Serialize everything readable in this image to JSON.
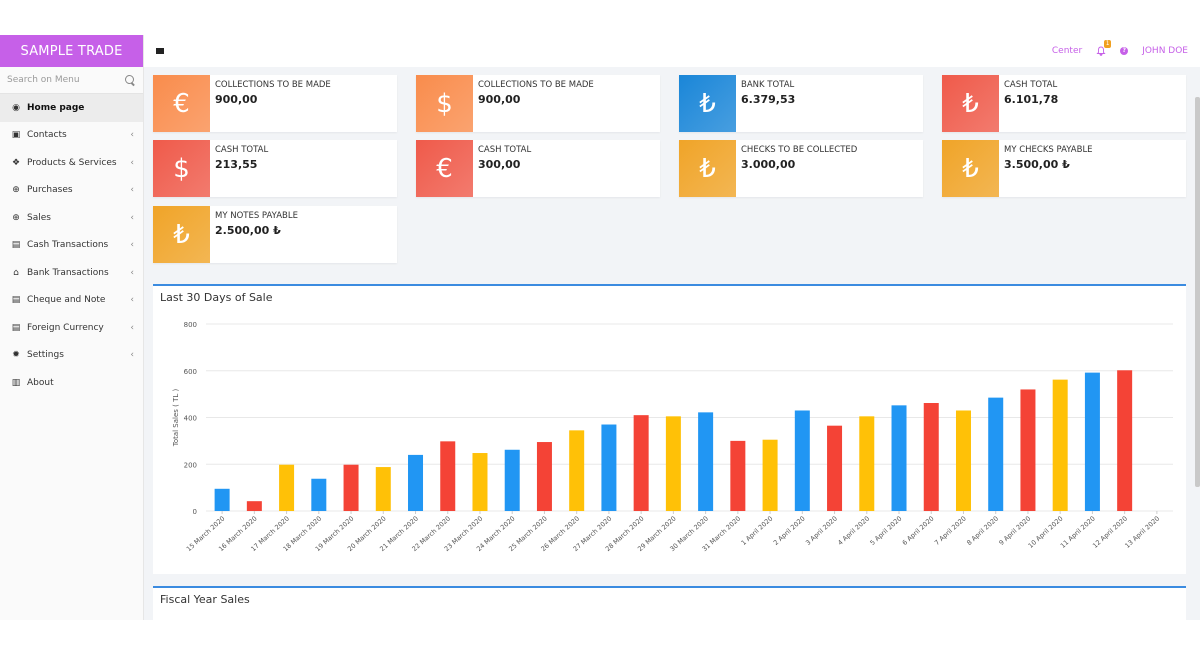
{
  "brand": "SAMPLE TRADE",
  "search": {
    "placeholder": "Search on Menu"
  },
  "sidebar": {
    "items": [
      {
        "label": "Home page",
        "icon": "dashboard-icon",
        "active": true,
        "chevron": false
      },
      {
        "label": "Contacts",
        "icon": "contacts-icon",
        "active": false,
        "chevron": true
      },
      {
        "label": "Products & Services",
        "icon": "products-icon",
        "active": false,
        "chevron": true
      },
      {
        "label": "Purchases",
        "icon": "purchases-icon",
        "active": false,
        "chevron": true
      },
      {
        "label": "Sales",
        "icon": "sales-icon",
        "active": false,
        "chevron": true
      },
      {
        "label": "Cash Transactions",
        "icon": "cash-icon",
        "active": false,
        "chevron": true
      },
      {
        "label": "Bank Transactions",
        "icon": "bank-icon",
        "active": false,
        "chevron": true
      },
      {
        "label": "Cheque and Note",
        "icon": "cheque-icon",
        "active": false,
        "chevron": true
      },
      {
        "label": "Foreign Currency",
        "icon": "currency-icon",
        "active": false,
        "chevron": true
      },
      {
        "label": "Settings",
        "icon": "settings-icon",
        "active": false,
        "chevron": true
      },
      {
        "label": "About",
        "icon": "about-icon",
        "active": false,
        "chevron": false
      }
    ]
  },
  "topbar": {
    "center": "Center",
    "notifications": "1",
    "help": "?",
    "user": "JOHN DOE"
  },
  "cards": [
    {
      "title": "COLLECTIONS TO BE MADE",
      "value": "900,00",
      "symbol": "€",
      "color": "#f98c4c"
    },
    {
      "title": "COLLECTIONS TO BE MADE",
      "value": "900,00",
      "symbol": "$",
      "color": "#f98c4c"
    },
    {
      "title": "BANK TOTAL",
      "value": "6.379,53",
      "symbol": "₺",
      "color": "#1a86d8"
    },
    {
      "title": "CASH TOTAL",
      "value": "6.101,78",
      "symbol": "₺",
      "color": "#ef5a4a"
    },
    {
      "title": "CASH TOTAL",
      "value": "213,55",
      "symbol": "$",
      "color": "#ef5a4a"
    },
    {
      "title": "CASH TOTAL",
      "value": "300,00",
      "symbol": "€",
      "color": "#ef5a4a"
    },
    {
      "title": "CHECKS TO BE COLLECTED",
      "value": "3.000,00",
      "symbol": "₺",
      "color": "#f0a428"
    },
    {
      "title": "MY CHECKS PAYABLE",
      "value": "3.500,00 ₺",
      "symbol": "₺",
      "color": "#f0a428"
    },
    {
      "title": "MY NOTES PAYABLE",
      "value": "2.500,00 ₺",
      "symbol": "₺",
      "color": "#f0a428"
    }
  ],
  "panels": {
    "sales_title": "Last 30 Days of Sale",
    "fiscal_title": "Fiscal Year Sales"
  },
  "chart_data": {
    "type": "bar",
    "ylabel": "Total Sales ( TL )",
    "xlabel": "",
    "ylim": [
      0,
      800
    ],
    "yticks": [
      0,
      200,
      400,
      600,
      800
    ],
    "grid": true,
    "colors": [
      "#2196f3",
      "#f44336",
      "#ffc107"
    ],
    "categories": [
      "15 March 2020",
      "16 March 2020",
      "17 March 2020",
      "18 March 2020",
      "19 March 2020",
      "20 March 2020",
      "21 March 2020",
      "22 March 2020",
      "23 March 2020",
      "24 March 2020",
      "25 March 2020",
      "26 March 2020",
      "27 March 2020",
      "28 March 2020",
      "29 March 2020",
      "30 March 2020",
      "31 March 2020",
      "1 April 2020",
      "2 April 2020",
      "3 April 2020",
      "4 April 2020",
      "5 April 2020",
      "6 April 2020",
      "7 April 2020",
      "8 April 2020",
      "9 April 2020",
      "10 April 2020",
      "11 April 2020",
      "12 April 2020",
      "13 April 2020"
    ],
    "values": [
      95,
      42,
      198,
      138,
      198,
      188,
      240,
      298,
      248,
      262,
      295,
      345,
      370,
      410,
      405,
      422,
      300,
      305,
      430,
      365,
      405,
      452,
      462,
      430,
      485,
      520,
      562,
      592,
      602,
      0
    ]
  }
}
